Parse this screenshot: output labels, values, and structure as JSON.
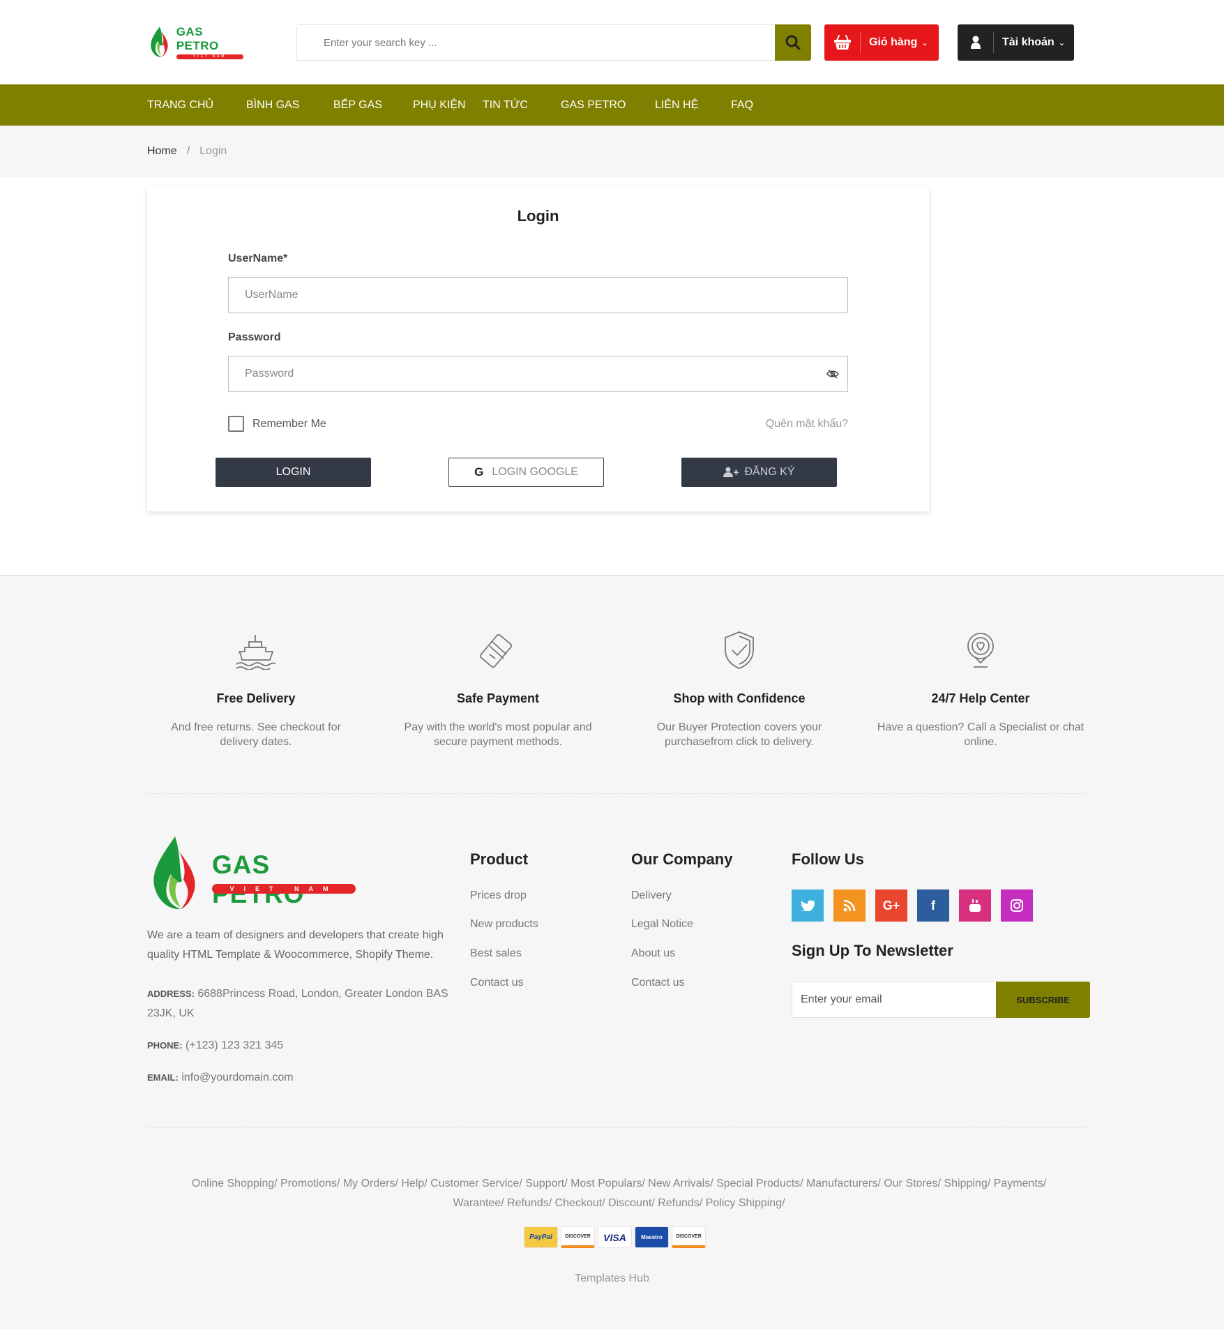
{
  "header": {
    "logo": {
      "name": "GAS PETRO",
      "tagline": "VIET NAM"
    },
    "search": {
      "placeholder": "Enter your search key ..."
    },
    "cart_label": "Giỏ hàng",
    "account_label": "Tài khoản"
  },
  "nav": {
    "items": [
      "TRANG CHỦ",
      "BÌNH GAS",
      "BẾP GAS",
      "PHỤ KIỆN",
      "TIN TỨC",
      "GAS PETRO",
      "LIÊN HỆ",
      "FAQ"
    ]
  },
  "breadcrumb": {
    "home": "Home",
    "separator": "/",
    "current": "Login"
  },
  "login": {
    "title": "Login",
    "username_label": "UserName*",
    "username_placeholder": "UserName",
    "password_label": "Password",
    "password_placeholder": "Password",
    "remember_label": "Remember Me",
    "forgot_label": "Quên mật khẩu?",
    "login_button": "LOGIN",
    "google_button": "LOGIN GOOGLE",
    "register_button": "ĐĂNG KÝ"
  },
  "features": [
    {
      "icon": "ship-icon",
      "title": "Free Delivery",
      "desc": "And free returns. See checkout for delivery dates."
    },
    {
      "icon": "card-icon",
      "title": "Safe Payment",
      "desc": "Pay with the world's most popular and secure payment methods."
    },
    {
      "icon": "shield-check-icon",
      "title": "Shop with Confidence",
      "desc": "Our Buyer Protection covers your purchasefrom click to delivery."
    },
    {
      "icon": "help-pin-icon",
      "title": "24/7 Help Center",
      "desc": "Have a question? Call a Specialist or chat online."
    }
  ],
  "footer": {
    "logo": {
      "name": "GAS PETRO",
      "tagline": "VIET NAM"
    },
    "about": "We are a team of designers and developers that create high quality HTML Template & Woocommerce, Shopify Theme.",
    "address_label": "ADDRESS:",
    "address": "6688Princess Road, London, Greater London BAS 23JK, UK",
    "phone_label": "PHONE:",
    "phone": "(+123) 123 321 345",
    "email_label": "EMAIL:",
    "email": "info@yourdomain.com",
    "product_title": "Product",
    "product_links": [
      "Prices drop",
      "New products",
      "Best sales",
      "Contact us"
    ],
    "company_title": "Our Company",
    "company_links": [
      "Delivery",
      "Legal Notice",
      "About us",
      "Contact us"
    ],
    "follow_title": "Follow Us",
    "social": [
      {
        "icon": "twitter-icon",
        "color": "#3eb0de"
      },
      {
        "icon": "rss-icon",
        "color": "#f39320"
      },
      {
        "icon": "google-plus-icon",
        "color": "#e8462e"
      },
      {
        "icon": "facebook-icon",
        "color": "#2e5d9e"
      },
      {
        "icon": "youtube-icon",
        "color": "#d7307f"
      },
      {
        "icon": "instagram-icon",
        "color": "#c42dbe"
      }
    ],
    "newsletter_title": "Sign Up To Newsletter",
    "newsletter_placeholder": "Enter your email",
    "subscribe_label": "SUBSCRIBE",
    "bottom_links": "Online Shopping/ Promotions/ My Orders/ Help/ Customer Service/ Support/ Most Populars/ New Arrivals/ Special Products/ Manufacturers/ Our Stores/ Shipping/ Payments/ Warantee/ Refunds/ Checkout/ Discount/ Refunds/ Policy Shipping/",
    "payments": [
      "PayPal",
      "DISCOVER",
      "VISA",
      "Maestro",
      "DISCOVER"
    ],
    "copyright": "Templates Hub"
  },
  "colors": {
    "accent": "#7f7f00",
    "cart": "#e6171b",
    "dark_button": "#343a45",
    "brand_green": "#1a9a3a",
    "brand_red": "#e32528"
  }
}
